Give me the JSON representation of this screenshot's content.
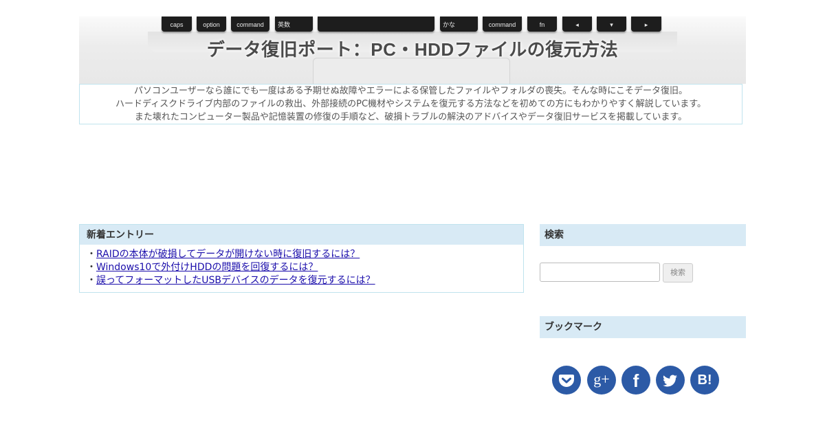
{
  "header": {
    "title": "データ復旧ポート：PC・HDDファイルの復元方法",
    "keys": [
      {
        "label": "caps"
      },
      {
        "label": "option"
      },
      {
        "label": "command"
      },
      {
        "label": "英数"
      },
      {
        "label": ""
      },
      {
        "label": "かな"
      },
      {
        "label": "command"
      },
      {
        "label": "fn"
      },
      {
        "label": "◂"
      },
      {
        "label": "▾"
      },
      {
        "label": "▸"
      }
    ]
  },
  "description": {
    "lines": [
      "パソコンユーザーなら誰にでも一度はある予期せぬ故障やエラーによる保管したファイルやフォルダの喪失。そんな時にこそデータ復旧。",
      "ハードディスクドライブ内部のファイルの救出、外部接続のPC機材やシステムを復元する方法などを初めての方にもわかりやすく解説しています。",
      "また壊れたコンピューター製品や記憶装置の修復の手順など、破損トラブルの解決のアドバイスやデータ復旧サービスを掲載しています。"
    ]
  },
  "entries": {
    "heading": "新着エントリー",
    "bullet": "・",
    "items": [
      {
        "text": "RAIDの本体が破損してデータが開けない時に復旧するには？"
      },
      {
        "text": "Windows10で外付けHDDの問題を回復するには？"
      },
      {
        "text": "誤ってフォーマットしたUSBデバイスのデータを復元するには？"
      }
    ]
  },
  "sidebar": {
    "search": {
      "heading": "検索",
      "input_value": "",
      "button_label": "検索"
    },
    "bookmark": {
      "heading": "ブックマーク",
      "icons": [
        "pocket-icon",
        "google-plus-icon",
        "facebook-icon",
        "twitter-icon",
        "hatena-bookmark-icon"
      ],
      "google_plus_text": "g+",
      "facebook_text": "f",
      "hatena_text": "B!"
    }
  },
  "colors": {
    "accent_blue": "#2c5aa6",
    "heading_bg": "#d8eaf5",
    "border_light_blue": "#bfe3ee",
    "link": "#1a0dab"
  }
}
